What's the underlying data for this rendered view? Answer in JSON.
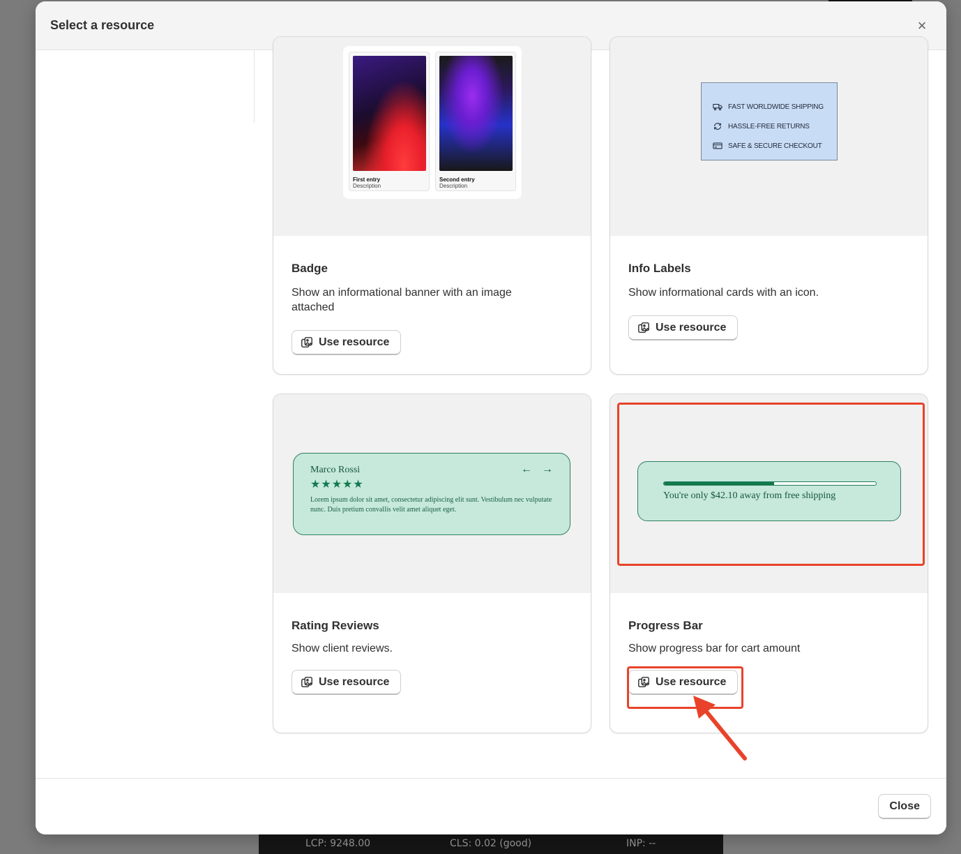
{
  "modal": {
    "title": "Select a resource",
    "close_icon": "×"
  },
  "cards": [
    {
      "title": "Badge",
      "description": "Show an informational banner with an image attached",
      "button": "Use resource",
      "preview": {
        "entries": [
          {
            "title": "First entry",
            "desc": "Description"
          },
          {
            "title": "Second entry",
            "desc": "Description"
          }
        ]
      }
    },
    {
      "title": "Info Labels",
      "description": "Show informational cards with an icon.",
      "button": "Use resource",
      "preview": {
        "rows": [
          {
            "icon": "truck-icon",
            "text": "FAST WORLDWIDE SHIPPING"
          },
          {
            "icon": "refresh-icon",
            "text": "HASSLE-FREE RETURNS"
          },
          {
            "icon": "credit-card-icon",
            "text": "SAFE & SECURE CHECKOUT"
          }
        ]
      }
    },
    {
      "title": "Rating Reviews",
      "description": "Show client reviews.",
      "button": "Use resource",
      "preview": {
        "name": "Marco Rossi",
        "stars": "★★★★★",
        "text": "Lorem ipsum dolor sit amet, consectetur adipiscing elit sunt. Vestibulum nec vulputate nunc. Duis pretium convallis velit amet aliquet eget.",
        "arrow_prev": "←",
        "arrow_next": "→"
      }
    },
    {
      "title": "Progress Bar",
      "description": "Show progress bar for cart amount",
      "button": "Use resource",
      "preview": {
        "text": "You're only $42.10 away from free shipping",
        "progress_fraction": 0.52
      }
    }
  ],
  "footer": {
    "close_label": "Close"
  },
  "perf": {
    "lcp": "LCP: 9248.00",
    "cls": "CLS: 0.02 (good)",
    "inp": "INP: --"
  },
  "colors": {
    "highlight": "#e8432a",
    "preview_green": "#c6e9dc",
    "info_blue": "#c9dcf5"
  }
}
